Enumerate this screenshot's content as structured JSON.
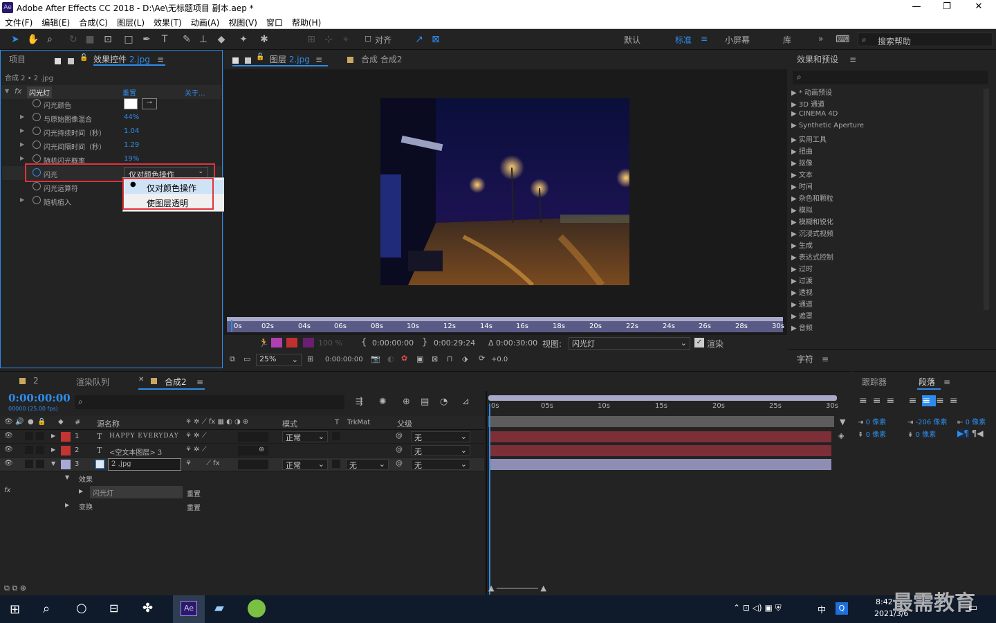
{
  "window": {
    "title": "Adobe After Effects CC 2018 - D:\\Ae\\无标题项目 副本.aep *",
    "app_badge": "Ae",
    "min": "—",
    "max": "❐",
    "close": "✕"
  },
  "menu": [
    "文件(F)",
    "编辑(E)",
    "合成(C)",
    "图层(L)",
    "效果(T)",
    "动画(A)",
    "视图(V)",
    "窗口",
    "帮助(H)"
  ],
  "toolbar": {
    "snap": "对齐",
    "workspaces": [
      "默认",
      "标准",
      "小屏幕",
      "库"
    ],
    "active_ws": "标准",
    "search_placeholder": "搜索帮助",
    "more": "»"
  },
  "left_panel": {
    "tab_project": "项目",
    "tab_effects": "效果控件",
    "tab_effects_file": "2.jpg",
    "breadcrumb": "合成 2 • 2 .jpg",
    "effect": {
      "name": "闪光灯",
      "reset": "重置",
      "about": "关于...",
      "props": [
        {
          "label": "闪光颜色",
          "value": ""
        },
        {
          "label": "与原始图像混合",
          "value": "44%"
        },
        {
          "label": "闪光持续时间（秒）",
          "value": "1.04"
        },
        {
          "label": "闪光间隔时间（秒）",
          "value": "1.29"
        },
        {
          "label": "随机闪光概率",
          "value": "19%"
        },
        {
          "label": "闪光",
          "value": "仅对颜色操作"
        },
        {
          "label": "闪光运算符",
          "value": ""
        },
        {
          "label": "随机植入",
          "value": ""
        }
      ]
    },
    "dropdown": {
      "options": [
        "仅对颜色操作",
        "使图层透明"
      ],
      "selected": "仅对颜色操作"
    }
  },
  "viewer": {
    "tab_layer": "图层",
    "tab_layer_file": "2.jpg",
    "tab_comp": "合成 合成2",
    "ticks": [
      "0s",
      "02s",
      "04s",
      "06s",
      "08s",
      "10s",
      "12s",
      "14s",
      "16s",
      "18s",
      "20s",
      "22s",
      "24s",
      "26s",
      "28s",
      "30s"
    ],
    "opacity": "100 %",
    "time_in": "0:00:00:00",
    "time_out": "0:00:29:24",
    "duration": "Δ 0:00:30:00",
    "view_label": "视图:",
    "view_value": "闪光灯",
    "render": "渲染",
    "zoom": "25%",
    "timecode": "0:00:00:00",
    "exposure": "+0.0"
  },
  "right_panel": {
    "title": "效果和预设",
    "categories": [
      "* 动画预设",
      "3D 通道",
      "CINEMA 4D",
      "Synthetic Aperture",
      "实用工具",
      "扭曲",
      "抠像",
      "文本",
      "时间",
      "杂色和颗粒",
      "模拟",
      "模糊和锐化",
      "沉浸式视频",
      "生成",
      "表达式控制",
      "过时",
      "过渡",
      "透视",
      "通道",
      "遮罩",
      "音频"
    ],
    "char_title": "字符"
  },
  "timeline": {
    "tabs": [
      "2",
      "渲染队列",
      "合成2"
    ],
    "timecode": "0:00:00:00",
    "fps": "00000 (25.00 fps)",
    "headers": {
      "num": "#",
      "src": "源名称",
      "mode": "模式",
      "t": "T",
      "trk": "TrkMat",
      "parent": "父级"
    },
    "layers": [
      {
        "num": "1",
        "type": "T",
        "name": "HAPPY EVERYDAY",
        "mode": "正常",
        "trk": "",
        "parent": "无",
        "color": "#c43434"
      },
      {
        "num": "2",
        "type": "T",
        "name": "<空文本图层> 3",
        "mode": "",
        "trk": "",
        "parent": "无",
        "color": "#c43434"
      },
      {
        "num": "3",
        "type": "img",
        "name": "2 .jpg",
        "mode": "正常",
        "trk": "无",
        "parent": "无",
        "color": "#a9a9d6"
      }
    ],
    "sub": {
      "effects": "效果",
      "effect_name": "闪光灯",
      "reset": "重置",
      "transform": "变换",
      "reset2": "重置"
    },
    "ticks": [
      "0s",
      "05s",
      "10s",
      "15s",
      "20s",
      "25s",
      "30s"
    ]
  },
  "right_bottom": {
    "tab_tracker": "跟踪器",
    "tab_para": "段落",
    "vals": [
      "0 像素",
      "-206 像素",
      "0 像素",
      "0 像素",
      "0 像素"
    ]
  },
  "taskbar": {
    "time": "8:42",
    "date": "2021/3/6",
    "ime": "中",
    "watermark": "最需教育"
  }
}
